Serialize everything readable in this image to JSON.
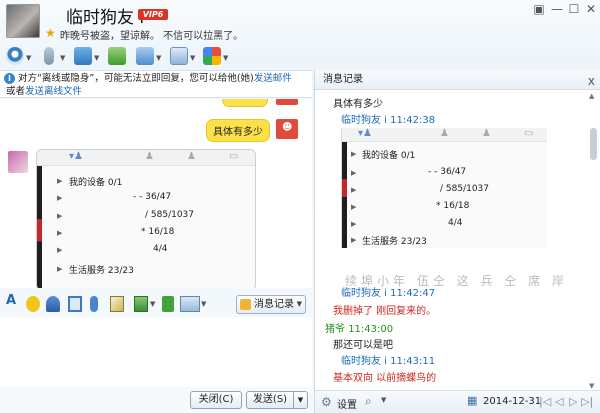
{
  "header": {
    "name": "临时狗友 i",
    "vip": "VIP6",
    "signature": "昨晚号被盗，望谅解。 不信可以拉黑了。"
  },
  "notice": {
    "line1_prefix": "对方“离线或隐身”，可能无法立即回复，您可以给他(她)",
    "line1_link": "发送邮件",
    "line2_prefix": "或者",
    "line2_link": "发送离线文件"
  },
  "chat": {
    "bubble_text": "具体有多少",
    "shot": {
      "rows": [
        "我的设备 0/1",
        "- - 36/47",
        "/ 585/1037",
        "* 16/18",
        "4/4",
        "生活服务 23/23"
      ]
    }
  },
  "input_toolbar": {
    "history_button": "消息记录"
  },
  "buttons": {
    "close": "关闭(C)",
    "send": "发送(S)"
  },
  "history": {
    "title": "消息记录",
    "close_icon": "x",
    "first_msg": "具体有多少",
    "entries": [
      {
        "sender": "临时狗友 i",
        "time": "11:42:38"
      },
      {
        "sender": "临时狗友 i",
        "time": "11:42:47",
        "text": "我删掉了   刚回复来的。"
      },
      {
        "sender": "猪爷",
        "time": "11:43:00",
        "text": "那还可以是吧"
      },
      {
        "sender": "临时狗友 i",
        "time": "11:43:11",
        "text": "基本双向  以前摘蝶鸟的"
      }
    ],
    "shot_rows": [
      "我的设备 0/1",
      "- - 36/47",
      "/ 585/1037",
      "* 16/18",
      "4/4",
      "生活服务 23/23"
    ],
    "blurred_line": "续埠小年 伍仝 这 兵 仝 席 岸",
    "footer": {
      "settings": "设置",
      "date": "2014-12-31"
    }
  },
  "colors": {
    "accent": "#1d6cc0",
    "self_name": "#239022",
    "peer_text": "#d0281e",
    "bubble": "#fde14a"
  }
}
